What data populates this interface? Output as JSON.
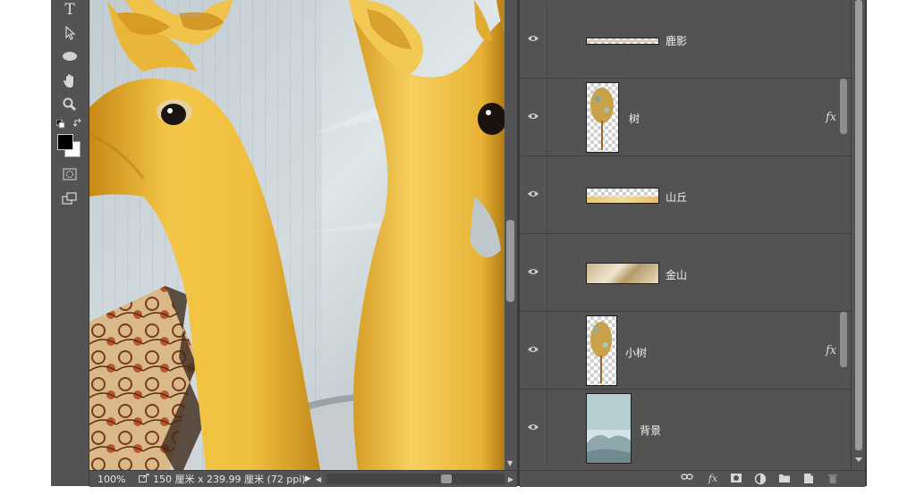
{
  "tools": [
    {
      "name": "type-tool",
      "glyph": "T"
    },
    {
      "name": "path-selection-tool",
      "glyph": "pointer"
    },
    {
      "name": "ellipse-tool",
      "glyph": "ellipse"
    },
    {
      "name": "hand-tool",
      "glyph": "hand"
    },
    {
      "name": "zoom-tool",
      "glyph": "magnifier"
    },
    {
      "name": "quick-mask-tool",
      "glyph": "mask"
    },
    {
      "name": "screen-mode-tool",
      "glyph": "screens"
    }
  ],
  "colors": {
    "foreground": "#000000",
    "background": "#ffffff",
    "panel": "#535353",
    "gold": "#e8b83c"
  },
  "statusbar": {
    "zoom": "100%",
    "doc_info": "150 厘米 x 239.99 厘米 (72 ppi)"
  },
  "layers": [
    {
      "name": "鹿影",
      "visible": true,
      "thumb": "strip-checker",
      "fx": false
    },
    {
      "name": "树",
      "visible": true,
      "thumb": "tree",
      "fx": true
    },
    {
      "name": "山丘",
      "visible": true,
      "thumb": "hill",
      "fx": false
    },
    {
      "name": "金山",
      "visible": true,
      "thumb": "gold-mountain",
      "fx": false
    },
    {
      "name": "小树",
      "visible": true,
      "thumb": "tree-small",
      "fx": true
    },
    {
      "name": "背景",
      "visible": true,
      "thumb": "background",
      "fx": false
    }
  ],
  "fx_label": "fx",
  "footer_icons": [
    "link-layers",
    "add-style",
    "add-mask",
    "adjustment-layer",
    "new-group",
    "new-layer",
    "delete-layer"
  ]
}
